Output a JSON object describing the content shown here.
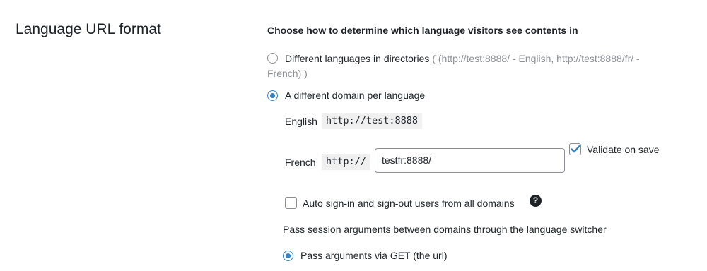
{
  "section": {
    "title": "Language URL format"
  },
  "main": {
    "heading": "Choose how to determine which language visitors see contents in",
    "options": {
      "directories": {
        "label": "Different languages in directories",
        "hint_line1": "( (http://test:8888/ - English, http://test:8888/fr/ -",
        "hint_line2": "French) )",
        "selected": false
      },
      "domain": {
        "label": "A different domain per language",
        "selected": true
      }
    },
    "domains": {
      "english": {
        "label": "English",
        "url": "http://test:8888"
      },
      "french": {
        "label": "French",
        "prefix": "http://",
        "value": "testfr:8888/"
      }
    },
    "validate": {
      "label": "Validate on save",
      "checked": true
    },
    "auto_sign": {
      "label": "Auto sign-in and sign-out users from all domains",
      "checked": false,
      "help_glyph": "?"
    },
    "session": {
      "label": "Pass session arguments between domains through the language switcher",
      "get_option": {
        "label": "Pass arguments via GET (the url)",
        "selected": true
      }
    }
  },
  "colors": {
    "accent": "#3582c4",
    "text": "#1d2327",
    "muted": "#8c8f94",
    "code_bg": "#f0f0f1"
  }
}
